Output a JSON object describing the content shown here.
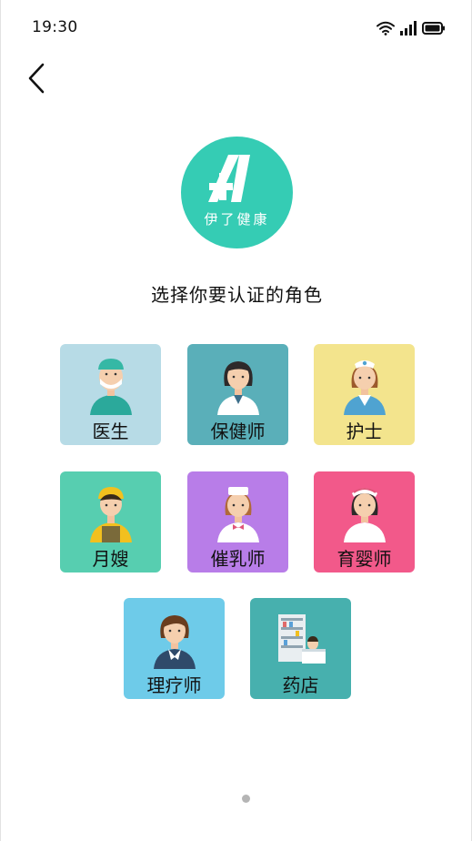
{
  "status_bar": {
    "time": "19:30"
  },
  "header": {
    "back_icon": "chevron-left-icon"
  },
  "logo": {
    "text": "伊了健康",
    "color": "#35ccb4"
  },
  "subtitle": "选择你要认证的角色",
  "roles": [
    {
      "label": "医生",
      "icon": "doctor-icon",
      "color": "#b7dbe6"
    },
    {
      "label": "保健师",
      "icon": "health-advisor-icon",
      "color": "#5aafb9"
    },
    {
      "label": "护士",
      "icon": "nurse-icon",
      "color": "#f3e48d"
    },
    {
      "label": "月嫂",
      "icon": "maternity-nanny-icon",
      "color": "#57ceb0"
    },
    {
      "label": "催乳师",
      "icon": "lactation-consultant-icon",
      "color": "#b87de8"
    },
    {
      "label": "育婴师",
      "icon": "childcare-icon",
      "color": "#f2598a"
    },
    {
      "label": "理疗师",
      "icon": "physiotherapist-icon",
      "color": "#6ecbe9"
    },
    {
      "label": "药店",
      "icon": "pharmacy-icon",
      "color": "#47b0ae"
    }
  ],
  "pager": {
    "pages": 1,
    "current": 1
  }
}
